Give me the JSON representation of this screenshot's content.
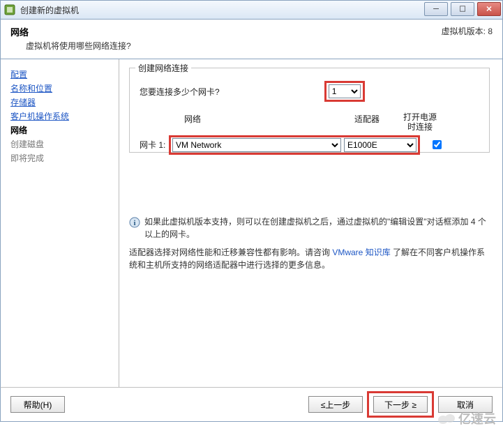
{
  "window": {
    "title": "创建新的虚拟机"
  },
  "header": {
    "title": "网络",
    "desc": "虚拟机将使用哪些网络连接?",
    "version_label": "虚拟机版本: 8"
  },
  "sidebar": {
    "items": [
      {
        "label": "配置",
        "state": "done"
      },
      {
        "label": "名称和位置",
        "state": "done"
      },
      {
        "label": "存储器",
        "state": "done"
      },
      {
        "label": "客户机操作系统",
        "state": "done"
      },
      {
        "label": "网络",
        "state": "current"
      },
      {
        "label": "创建磁盘",
        "state": "pending"
      },
      {
        "label": "即将完成",
        "state": "pending"
      }
    ]
  },
  "group": {
    "legend": "创建网络连接",
    "question": "您要连接多少个网卡?",
    "nic_count_value": "1",
    "col_network": "网络",
    "col_adapter": "适配器",
    "col_connect_line1": "打开电源",
    "col_connect_line2": "时连接",
    "nic1_label": "网卡 1:",
    "nic1_network": "VM Network",
    "nic1_adapter": "E1000E",
    "nic1_connect": true
  },
  "info": {
    "para1": "如果此虚拟机版本支持，则可以在创建虚拟机之后，通过虚拟机的\"编辑设置\"对话框添加 4 个以上的网卡。",
    "para2a": "适配器选择对网络性能和迁移兼容性都有影响。请咨询 ",
    "kb_link": "VMware 知识库",
    "para2b": " 了解在不同客户机操作系统和主机所支持的网络适配器中进行选择的更多信息。"
  },
  "footer": {
    "help": "帮助(H)",
    "back": "≤上一步",
    "next": "下一步 ≥",
    "cancel": "取消"
  },
  "watermark": {
    "text": "亿速云"
  }
}
